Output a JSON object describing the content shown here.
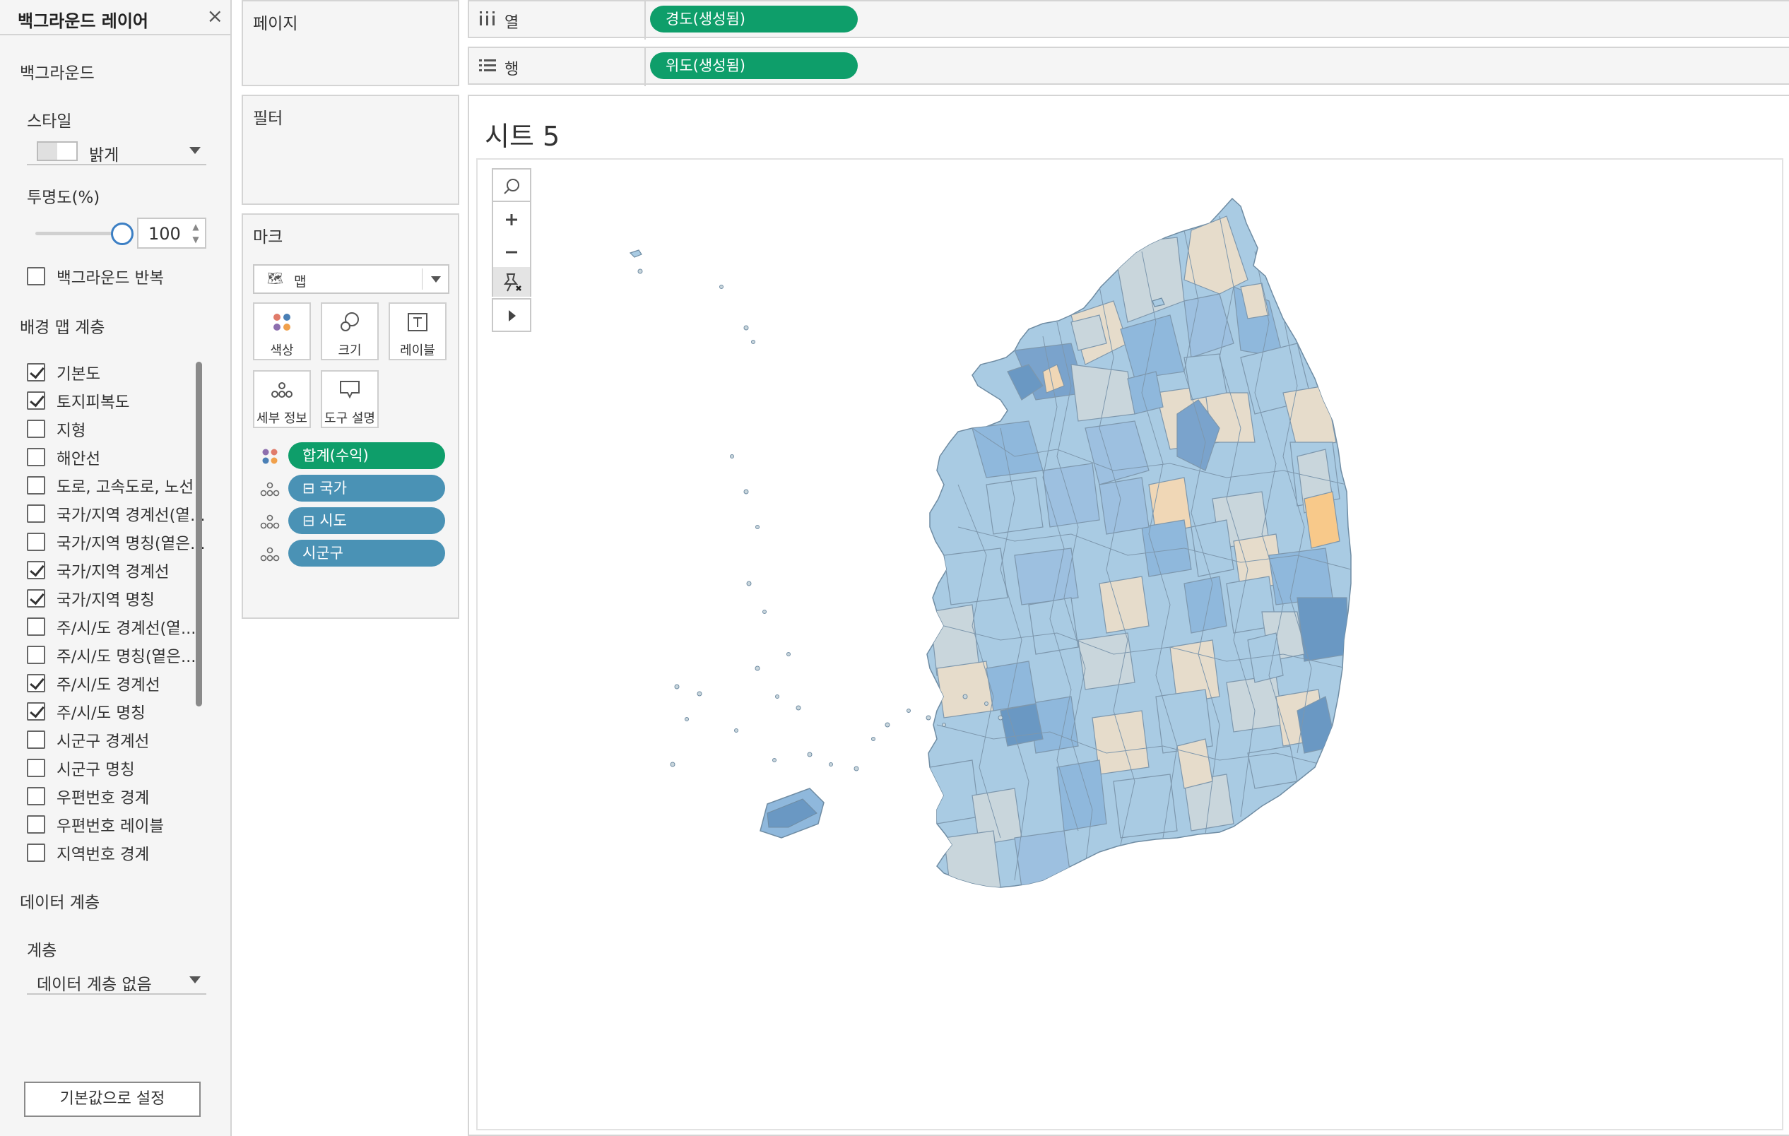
{
  "background_panel": {
    "title": "백그라운드 레이어",
    "section_background": "백그라운드",
    "style_label": "스타일",
    "style_value": "밝게",
    "opacity_label": "투명도(%)",
    "opacity_value": "100",
    "repeat_label": "백그라운드 반복",
    "map_layers_label": "배경 맵 계층",
    "layers": [
      {
        "label": "기본도",
        "checked": true
      },
      {
        "label": "토지피복도",
        "checked": true
      },
      {
        "label": "지형",
        "checked": false
      },
      {
        "label": "해안선",
        "checked": false
      },
      {
        "label": "도로, 고속도로, 노선",
        "checked": false
      },
      {
        "label": "국가/지역 경계선(옅...",
        "checked": false
      },
      {
        "label": "국가/지역 명칭(옅은...",
        "checked": false
      },
      {
        "label": "국가/지역 경계선",
        "checked": true
      },
      {
        "label": "국가/지역 명칭",
        "checked": true
      },
      {
        "label": "주/시/도 경계선(옅...",
        "checked": false
      },
      {
        "label": "주/시/도 명칭(옅은...",
        "checked": false
      },
      {
        "label": "주/시/도 경계선",
        "checked": true
      },
      {
        "label": "주/시/도 명칭",
        "checked": true
      },
      {
        "label": "시군구 경계선",
        "checked": false
      },
      {
        "label": "시군구 명칭",
        "checked": false
      },
      {
        "label": "우편번호 경계",
        "checked": false
      },
      {
        "label": "우편번호 레이블",
        "checked": false
      },
      {
        "label": "지역번호 경계",
        "checked": false
      }
    ],
    "data_layer_label": "데이터 계층",
    "layer_label": "계층",
    "layer_value": "데이터 계층 없음",
    "reset_button": "기본값으로 설정"
  },
  "pages_card": {
    "title": "페이지"
  },
  "filters_card": {
    "title": "필터"
  },
  "marks_card": {
    "title": "마크",
    "mark_type": "맵",
    "buttons": [
      {
        "label": "색상",
        "icon": "color-icon"
      },
      {
        "label": "크기",
        "icon": "size-icon"
      },
      {
        "label": "레이블",
        "icon": "label-icon"
      },
      {
        "label": "세부 정보",
        "icon": "detail-icon"
      },
      {
        "label": "도구 설명",
        "icon": "tooltip-icon"
      }
    ],
    "fields": [
      {
        "label": "합계(수익)",
        "kind": "color"
      },
      {
        "label": "⊟ 국가",
        "kind": "detail"
      },
      {
        "label": "⊟ 시도",
        "kind": "detail"
      },
      {
        "label": "시군구",
        "kind": "detail"
      }
    ]
  },
  "shelves": {
    "columns": {
      "label": "열",
      "pill": "경도(생성됨)"
    },
    "rows": {
      "label": "행",
      "pill": "위도(생성됨)"
    }
  },
  "sheet": {
    "title": "시트 5"
  },
  "colors": {
    "accent_green": "#0e9e6a",
    "detail_blue": "#4a92b5",
    "map_light_blue": "#a9cbe3",
    "map_mid_blue": "#8fb8dc",
    "map_dark_blue": "#6a98c3",
    "map_beige": "#e6dccb",
    "map_orange": "#f8c98a"
  }
}
